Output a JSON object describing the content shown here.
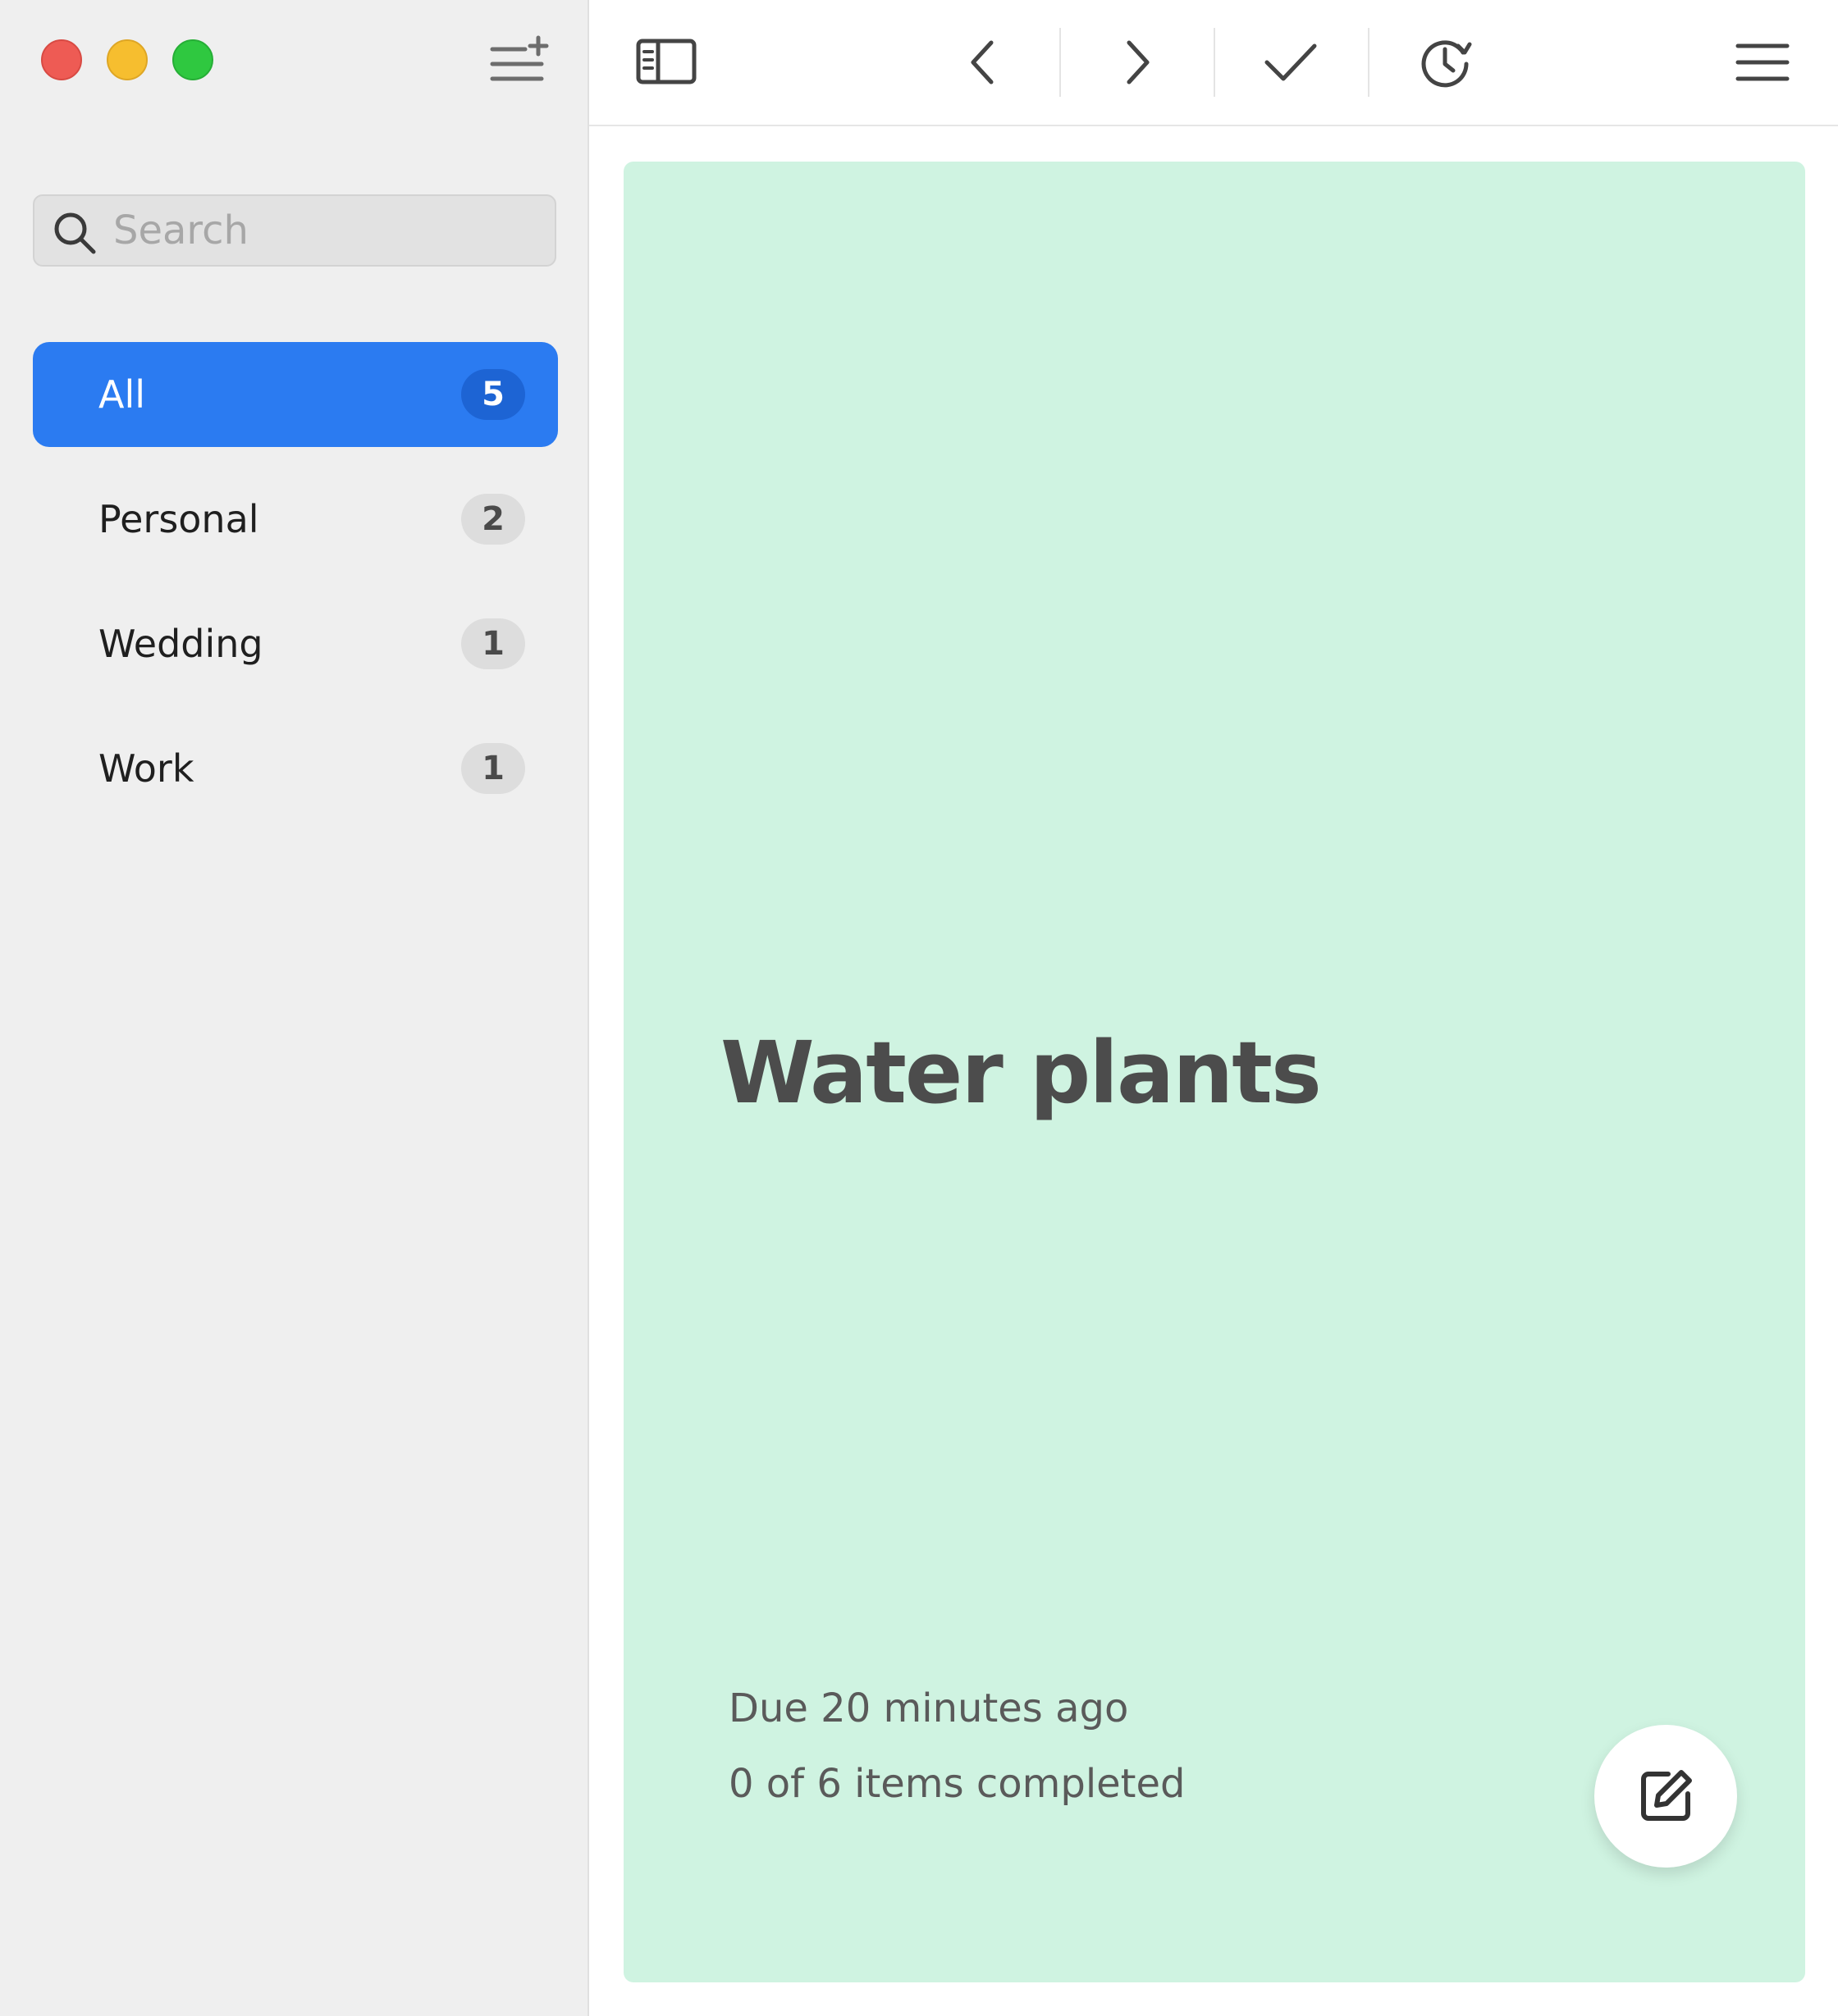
{
  "window": {
    "controls": [
      "close",
      "minimize",
      "zoom"
    ]
  },
  "sidebar": {
    "new_list_icon": "list-add-icon",
    "search": {
      "placeholder": "Search",
      "value": "",
      "icon": "search-icon"
    },
    "lists": [
      {
        "label": "All",
        "count": "5",
        "selected": true
      },
      {
        "label": "Personal",
        "count": "2",
        "selected": false
      },
      {
        "label": "Wedding",
        "count": "1",
        "selected": false
      },
      {
        "label": "Work",
        "count": "1",
        "selected": false
      }
    ]
  },
  "toolbar": {
    "icons": [
      "sidebar-toggle-icon",
      "chevron-left-icon",
      "chevron-right-icon",
      "checkmark-icon",
      "snooze-clock-icon",
      "hamburger-menu-icon"
    ]
  },
  "card": {
    "title": "Water plants",
    "due": "Due 20 minutes ago",
    "progress": "0 of 6 items completed",
    "background": "#cff3e1",
    "edit_icon": "edit-icon"
  },
  "colors": {
    "accent": "#2b7bf1",
    "sidebar_bg": "#efefef",
    "close": "#ee5b54",
    "minimize": "#f6be2f",
    "zoom": "#2fc840"
  }
}
